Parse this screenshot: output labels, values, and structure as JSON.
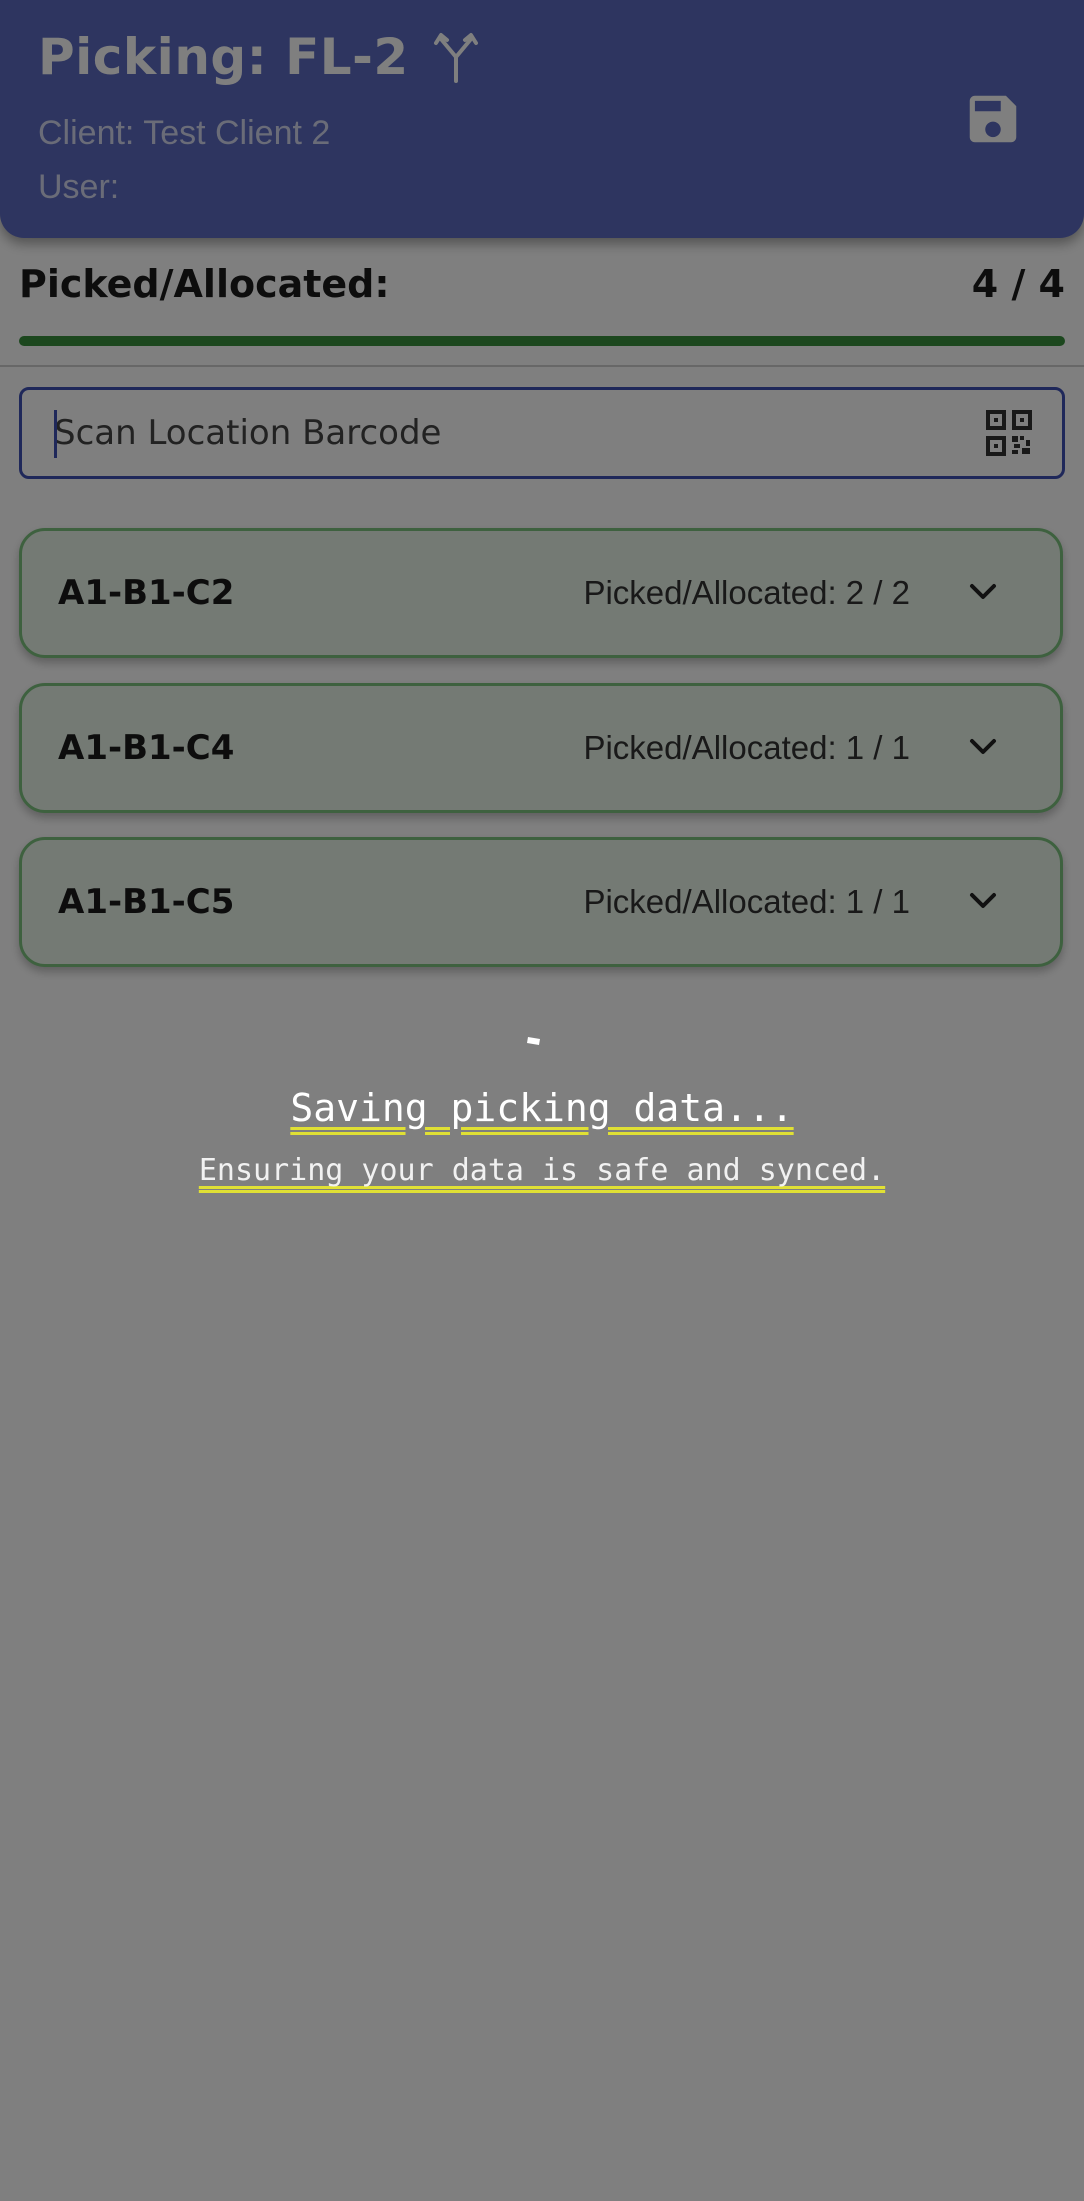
{
  "header": {
    "title": "Picking: FL-2",
    "client": "Client: Test Client 2",
    "user": "User:",
    "icons": {
      "title": "fork-split-icon",
      "action": "save-icon"
    }
  },
  "summary": {
    "label": "Picked/Allocated:",
    "value": "4 / 4",
    "progress_fraction": 1.0
  },
  "scan": {
    "placeholder": "Scan Location Barcode",
    "value": "",
    "icon": "qr-code-scan-icon"
  },
  "locations": [
    {
      "name": "A1-B1-C2",
      "count": "Picked/Allocated: 2 / 2"
    },
    {
      "name": "A1-B1-C4",
      "count": "Picked/Allocated: 1 / 1"
    },
    {
      "name": "A1-B1-C5",
      "count": "Picked/Allocated: 1 / 1"
    }
  ],
  "loading": {
    "title": "Saving picking data...",
    "subtitle": "Ensuring your data is safe and synced."
  },
  "colors": {
    "header_bg": "#5c6bc0",
    "accent": "#3f51b5",
    "progress": "#388e3c",
    "card_bg": "#e8f5e9",
    "card_border": "#7cc37f",
    "underline": "#e0e034"
  }
}
